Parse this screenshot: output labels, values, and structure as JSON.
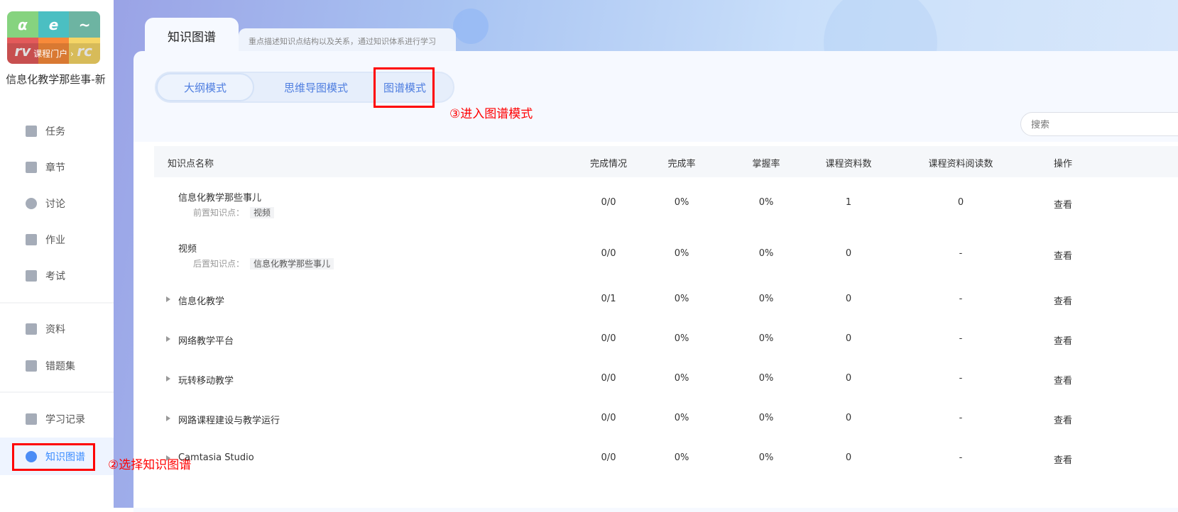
{
  "sidebar": {
    "logo_text": "课程门户",
    "logo_arrow": "›",
    "course_title": "信息化教学那些事-新",
    "items": [
      {
        "label": "任务",
        "icon": "grid-icon"
      },
      {
        "label": "章节",
        "icon": "list-icon"
      },
      {
        "label": "讨论",
        "icon": "chat-icon"
      },
      {
        "label": "作业",
        "icon": "edit-icon"
      },
      {
        "label": "考试",
        "icon": "exam-icon"
      },
      {
        "label": "资料",
        "icon": "folder-icon"
      },
      {
        "label": "错题集",
        "icon": "wrong-icon"
      },
      {
        "label": "学习记录",
        "icon": "pencil-icon"
      },
      {
        "label": "知识图谱",
        "icon": "graph-icon",
        "active": true
      }
    ]
  },
  "header": {
    "tab_title": "知识图谱",
    "tab_subtitle": "重点描述知识点结构以及关系，通过知识体系进行学习"
  },
  "modes": {
    "items": [
      "大纲模式",
      "思维导图模式",
      "图谱模式"
    ],
    "selected": "大纲模式"
  },
  "annotations": {
    "step2": "②选择知识图谱",
    "step3": "③进入图谱模式",
    "color": "#ff0000"
  },
  "search": {
    "placeholder": "搜索"
  },
  "table": {
    "headers": [
      "知识点名称",
      "完成情况",
      "完成率",
      "掌握率",
      "课程资料数",
      "课程资料阅读数",
      "操作"
    ],
    "rows": [
      {
        "name": "信息化教学那些事儿",
        "relation_label": "前置知识点：",
        "relation": "视频",
        "done": "0/0",
        "rate": "0%",
        "mastery": "0%",
        "materials": "1",
        "reads": "0",
        "action": "查看"
      },
      {
        "name": "视频",
        "relation_label": "后置知识点：",
        "relation": "信息化教学那些事儿",
        "done": "0/0",
        "rate": "0%",
        "mastery": "0%",
        "materials": "0",
        "reads": "-",
        "action": "查看"
      },
      {
        "name": "信息化教学",
        "done": "0/1",
        "rate": "0%",
        "mastery": "0%",
        "materials": "0",
        "reads": "-",
        "action": "查看"
      },
      {
        "name": "网络教学平台",
        "done": "0/0",
        "rate": "0%",
        "mastery": "0%",
        "materials": "0",
        "reads": "-",
        "action": "查看"
      },
      {
        "name": "玩转移动教学",
        "done": "0/0",
        "rate": "0%",
        "mastery": "0%",
        "materials": "0",
        "reads": "-",
        "action": "查看"
      },
      {
        "name": "网路课程建设与教学运行",
        "done": "0/0",
        "rate": "0%",
        "mastery": "0%",
        "materials": "0",
        "reads": "-",
        "action": "查看"
      },
      {
        "name": "Camtasia Studio",
        "done": "0/0",
        "rate": "0%",
        "mastery": "0%",
        "materials": "0",
        "reads": "-",
        "action": "查看"
      }
    ]
  }
}
